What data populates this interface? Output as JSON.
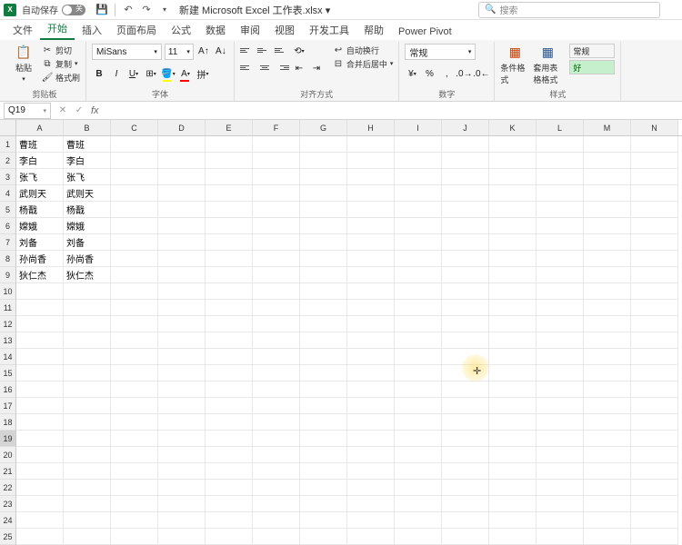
{
  "titlebar": {
    "autosave_label": "自动保存",
    "autosave_state": "关",
    "doc_title": "新建 Microsoft Excel 工作表.xlsx ▾",
    "search_placeholder": "搜索"
  },
  "tabs": [
    "文件",
    "开始",
    "插入",
    "页面布局",
    "公式",
    "数据",
    "审阅",
    "视图",
    "开发工具",
    "帮助",
    "Power Pivot"
  ],
  "active_tab": 1,
  "ribbon": {
    "clipboard": {
      "label": "剪贴板",
      "paste": "粘贴",
      "cut": "剪切",
      "copy": "复制",
      "format_painter": "格式刷"
    },
    "font": {
      "label": "字体",
      "name": "MiSans",
      "size": "11"
    },
    "alignment": {
      "label": "对齐方式",
      "wrap": "自动换行",
      "merge": "合并后居中"
    },
    "number": {
      "label": "数字",
      "format": "常规"
    },
    "styles": {
      "label": "样式",
      "cond_fmt": "条件格式",
      "table_fmt": "套用表格格式",
      "normal": "常规",
      "good": "好"
    }
  },
  "formula_bar": {
    "cell_ref": "Q19",
    "formula": ""
  },
  "columns": [
    "A",
    "B",
    "C",
    "D",
    "E",
    "F",
    "G",
    "H",
    "I",
    "J",
    "K",
    "L",
    "M",
    "N"
  ],
  "rows": 25,
  "selected_row": 19,
  "cells": {
    "A1": "曹班",
    "B1": "曹班",
    "A2": "李白",
    "B2": "李白",
    "A3": "张飞",
    "B3": "张飞",
    "A4": "武则天",
    "B4": "武则天",
    "A5": "杨戬",
    "B5": "杨戬",
    "A6": "嫦娥",
    "B6": "嫦娥",
    "A7": "刘备",
    "B7": "刘备",
    "A8": "孙尚香",
    "B8": "孙尚香",
    "A9": "狄仁杰",
    "B9": "狄仁杰"
  }
}
